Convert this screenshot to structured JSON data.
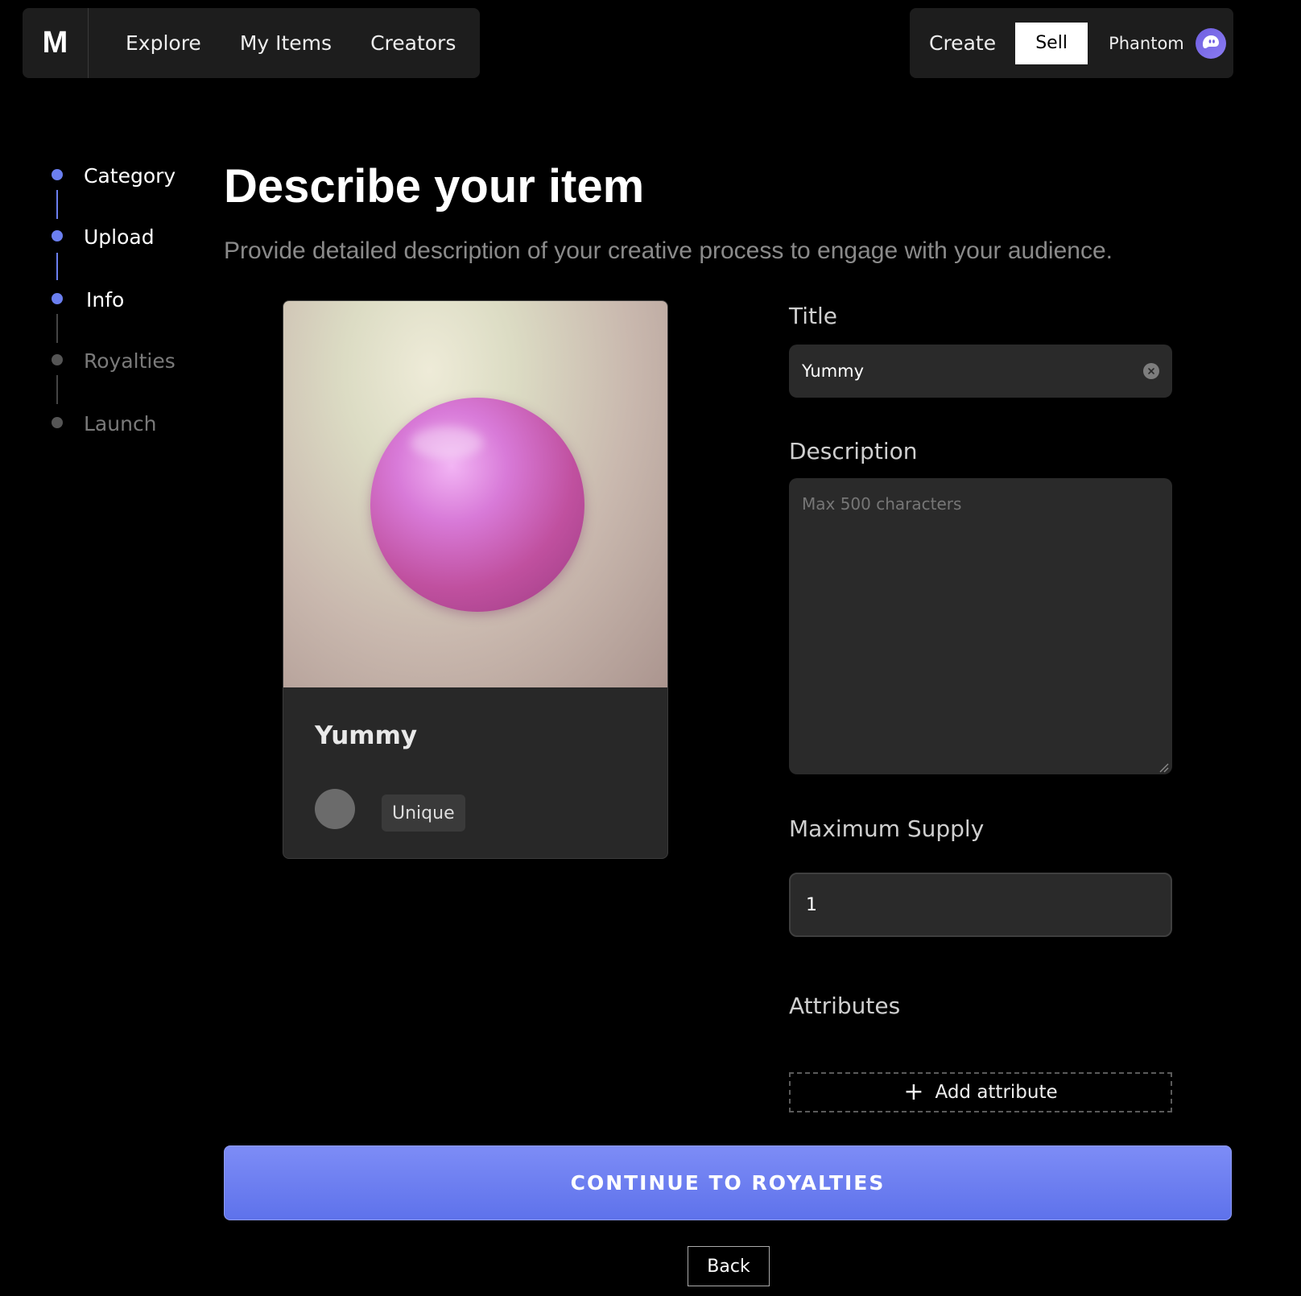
{
  "nav": {
    "logo": "M",
    "links": [
      "Explore",
      "My Items",
      "Creators"
    ],
    "create_label": "Create",
    "sell_label": "Sell",
    "wallet_label": "Phantom",
    "wallet_icon": "phantom-ghost-icon"
  },
  "stepper": {
    "steps": [
      {
        "label": "Category",
        "state": "complete"
      },
      {
        "label": "Upload",
        "state": "complete"
      },
      {
        "label": "Info",
        "state": "active"
      },
      {
        "label": "Royalties",
        "state": "pending"
      },
      {
        "label": "Launch",
        "state": "pending"
      }
    ],
    "active_color": "#6b7ff0",
    "pending_color": "#555555"
  },
  "page": {
    "title": "Describe your item",
    "subtitle": "Provide detailed description of your creative process to engage with your audience."
  },
  "preview": {
    "title": "Yummy",
    "edition": "Unique"
  },
  "form": {
    "title_label": "Title",
    "title_value": "Yummy",
    "description_label": "Description",
    "description_placeholder": "Max 500 characters",
    "description_value": "",
    "supply_label": "Maximum Supply",
    "supply_value": "1",
    "attributes_label": "Attributes",
    "add_attribute_label": "Add attribute"
  },
  "actions": {
    "continue_label": "CONTINUE TO ROYALTIES",
    "back_label": "Back"
  },
  "colors": {
    "accent": "#6b7ff0",
    "background": "#000000",
    "surface": "#2a2a2a"
  }
}
